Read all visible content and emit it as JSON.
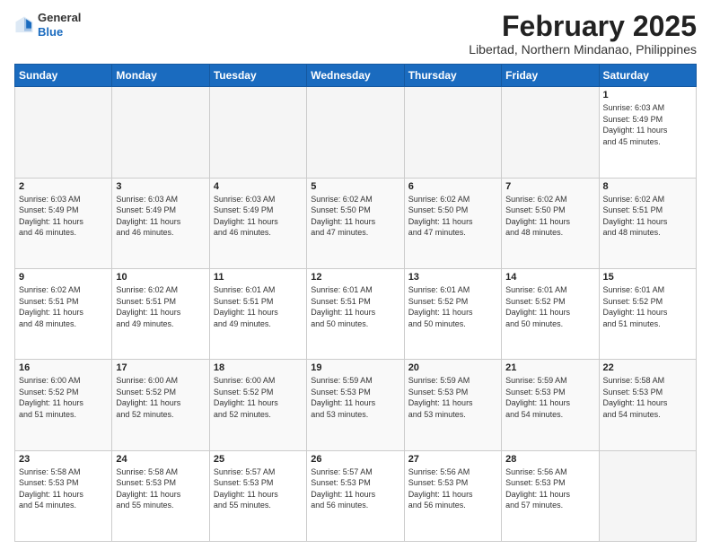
{
  "header": {
    "logo_general": "General",
    "logo_blue": "Blue",
    "title": "February 2025",
    "subtitle": "Libertad, Northern Mindanao, Philippines"
  },
  "days_of_week": [
    "Sunday",
    "Monday",
    "Tuesday",
    "Wednesday",
    "Thursday",
    "Friday",
    "Saturday"
  ],
  "weeks": [
    [
      {
        "day": "",
        "info": ""
      },
      {
        "day": "",
        "info": ""
      },
      {
        "day": "",
        "info": ""
      },
      {
        "day": "",
        "info": ""
      },
      {
        "day": "",
        "info": ""
      },
      {
        "day": "",
        "info": ""
      },
      {
        "day": "1",
        "info": "Sunrise: 6:03 AM\nSunset: 5:49 PM\nDaylight: 11 hours\nand 45 minutes."
      }
    ],
    [
      {
        "day": "2",
        "info": "Sunrise: 6:03 AM\nSunset: 5:49 PM\nDaylight: 11 hours\nand 46 minutes."
      },
      {
        "day": "3",
        "info": "Sunrise: 6:03 AM\nSunset: 5:49 PM\nDaylight: 11 hours\nand 46 minutes."
      },
      {
        "day": "4",
        "info": "Sunrise: 6:03 AM\nSunset: 5:49 PM\nDaylight: 11 hours\nand 46 minutes."
      },
      {
        "day": "5",
        "info": "Sunrise: 6:02 AM\nSunset: 5:50 PM\nDaylight: 11 hours\nand 47 minutes."
      },
      {
        "day": "6",
        "info": "Sunrise: 6:02 AM\nSunset: 5:50 PM\nDaylight: 11 hours\nand 47 minutes."
      },
      {
        "day": "7",
        "info": "Sunrise: 6:02 AM\nSunset: 5:50 PM\nDaylight: 11 hours\nand 48 minutes."
      },
      {
        "day": "8",
        "info": "Sunrise: 6:02 AM\nSunset: 5:51 PM\nDaylight: 11 hours\nand 48 minutes."
      }
    ],
    [
      {
        "day": "9",
        "info": "Sunrise: 6:02 AM\nSunset: 5:51 PM\nDaylight: 11 hours\nand 48 minutes."
      },
      {
        "day": "10",
        "info": "Sunrise: 6:02 AM\nSunset: 5:51 PM\nDaylight: 11 hours\nand 49 minutes."
      },
      {
        "day": "11",
        "info": "Sunrise: 6:01 AM\nSunset: 5:51 PM\nDaylight: 11 hours\nand 49 minutes."
      },
      {
        "day": "12",
        "info": "Sunrise: 6:01 AM\nSunset: 5:51 PM\nDaylight: 11 hours\nand 50 minutes."
      },
      {
        "day": "13",
        "info": "Sunrise: 6:01 AM\nSunset: 5:52 PM\nDaylight: 11 hours\nand 50 minutes."
      },
      {
        "day": "14",
        "info": "Sunrise: 6:01 AM\nSunset: 5:52 PM\nDaylight: 11 hours\nand 50 minutes."
      },
      {
        "day": "15",
        "info": "Sunrise: 6:01 AM\nSunset: 5:52 PM\nDaylight: 11 hours\nand 51 minutes."
      }
    ],
    [
      {
        "day": "16",
        "info": "Sunrise: 6:00 AM\nSunset: 5:52 PM\nDaylight: 11 hours\nand 51 minutes."
      },
      {
        "day": "17",
        "info": "Sunrise: 6:00 AM\nSunset: 5:52 PM\nDaylight: 11 hours\nand 52 minutes."
      },
      {
        "day": "18",
        "info": "Sunrise: 6:00 AM\nSunset: 5:52 PM\nDaylight: 11 hours\nand 52 minutes."
      },
      {
        "day": "19",
        "info": "Sunrise: 5:59 AM\nSunset: 5:53 PM\nDaylight: 11 hours\nand 53 minutes."
      },
      {
        "day": "20",
        "info": "Sunrise: 5:59 AM\nSunset: 5:53 PM\nDaylight: 11 hours\nand 53 minutes."
      },
      {
        "day": "21",
        "info": "Sunrise: 5:59 AM\nSunset: 5:53 PM\nDaylight: 11 hours\nand 54 minutes."
      },
      {
        "day": "22",
        "info": "Sunrise: 5:58 AM\nSunset: 5:53 PM\nDaylight: 11 hours\nand 54 minutes."
      }
    ],
    [
      {
        "day": "23",
        "info": "Sunrise: 5:58 AM\nSunset: 5:53 PM\nDaylight: 11 hours\nand 54 minutes."
      },
      {
        "day": "24",
        "info": "Sunrise: 5:58 AM\nSunset: 5:53 PM\nDaylight: 11 hours\nand 55 minutes."
      },
      {
        "day": "25",
        "info": "Sunrise: 5:57 AM\nSunset: 5:53 PM\nDaylight: 11 hours\nand 55 minutes."
      },
      {
        "day": "26",
        "info": "Sunrise: 5:57 AM\nSunset: 5:53 PM\nDaylight: 11 hours\nand 56 minutes."
      },
      {
        "day": "27",
        "info": "Sunrise: 5:56 AM\nSunset: 5:53 PM\nDaylight: 11 hours\nand 56 minutes."
      },
      {
        "day": "28",
        "info": "Sunrise: 5:56 AM\nSunset: 5:53 PM\nDaylight: 11 hours\nand 57 minutes."
      },
      {
        "day": "",
        "info": ""
      }
    ]
  ]
}
